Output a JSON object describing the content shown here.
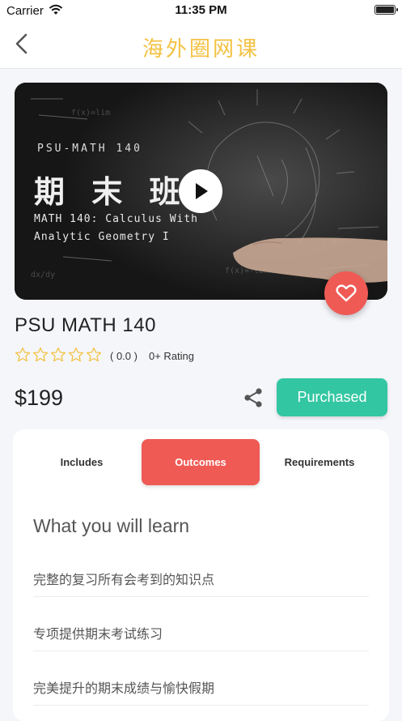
{
  "status_bar": {
    "carrier": "Carrier",
    "time": "11:35 PM"
  },
  "nav": {
    "title": "海外圈网课",
    "title_color": "#f3c244"
  },
  "hero": {
    "subtitle": "PSU-MATH 140",
    "title": "期 末 班",
    "description": "MATH 140: Calculus With\nAnalytic Geometry I"
  },
  "course": {
    "title": "PSU MATH 140",
    "rating_value": "( 0.0 )",
    "rating_count": "0+ Rating",
    "stars_filled": 0,
    "stars_total": 5,
    "price": "$199",
    "purchase_label": "Purchased"
  },
  "tabs": [
    {
      "label": "Includes",
      "active": false
    },
    {
      "label": "Outcomes",
      "active": true
    },
    {
      "label": "Requirements",
      "active": false
    }
  ],
  "outcomes": {
    "heading": "What you will learn",
    "items": [
      "完整的复习所有会考到的知识点",
      "专项提供期末考试练习",
      "完美提升的期末成绩与愉快假期"
    ]
  },
  "colors": {
    "accent_red": "#ef5a55",
    "accent_green": "#33c6a2",
    "star_outline": "#f3c244"
  }
}
